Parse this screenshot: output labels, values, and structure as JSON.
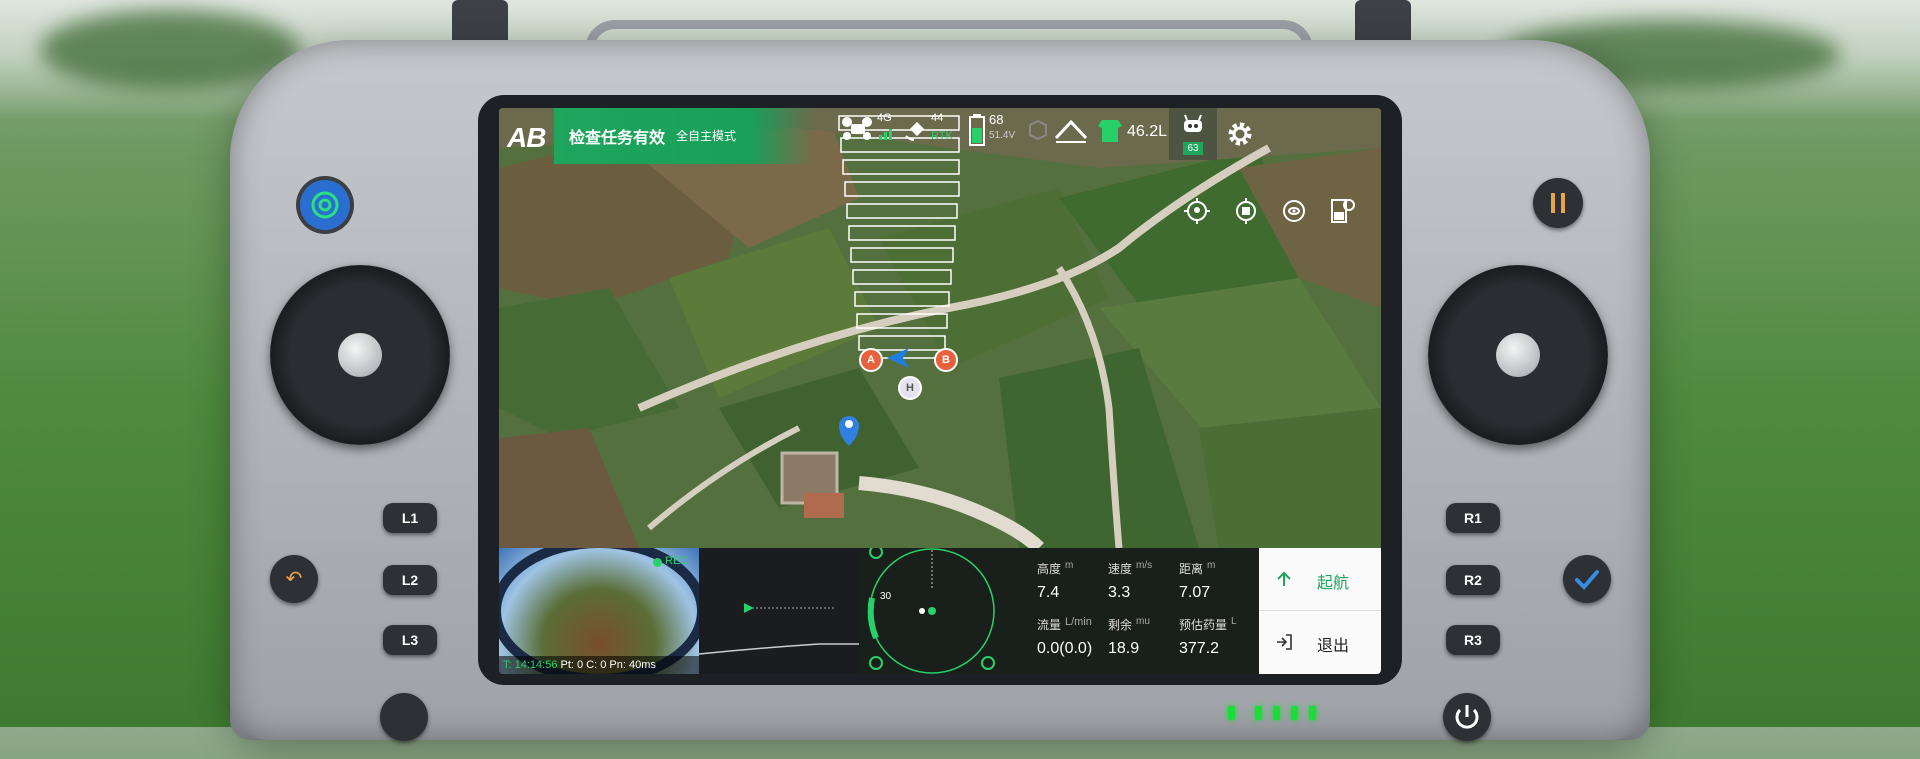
{
  "status_bar": {
    "logo": "AB",
    "task_status": "检查任务有效",
    "mode": "全自主模式",
    "signal_4g": "4G",
    "rtk_value": "44",
    "rtk_label": "RTK",
    "battery_percent": "68",
    "battery_voltage": "51.4V",
    "tank_volume": "46.2L",
    "drone_badge": "63"
  },
  "map": {
    "point_a": "A",
    "point_b": "B",
    "home_point": "H"
  },
  "camera": {
    "record_tag": "REC",
    "time_label": "T: 14:14:56",
    "stats": "Pt: 0 C: 0 Pn: 40ms"
  },
  "radar": {
    "heading": "30"
  },
  "telemetry": {
    "height_label": "高度",
    "height_unit": "m",
    "height_value": "7.4",
    "speed_label": "速度",
    "speed_unit": "m/s",
    "speed_value": "3.3",
    "distance_label": "距离",
    "distance_unit": "m",
    "distance_value": "7.07",
    "flow_label": "流量",
    "flow_unit": "L/min",
    "flow_value": "0.0(0.0)",
    "remaining_label": "剩余",
    "remaining_unit": "mu",
    "remaining_value": "18.9",
    "estimated_label": "预估药量",
    "estimated_unit": "L",
    "estimated_value": "377.2"
  },
  "actions": {
    "takeoff_label": "起航",
    "exit_label": "退出"
  },
  "controller": {
    "left_buttons": [
      "L1",
      "L2",
      "L3"
    ],
    "right_buttons": [
      "R1",
      "R2",
      "R3"
    ]
  },
  "colors": {
    "accent_green": "#1fa55c",
    "point_orange": "#e8603c",
    "route_white": "#ffffff"
  }
}
